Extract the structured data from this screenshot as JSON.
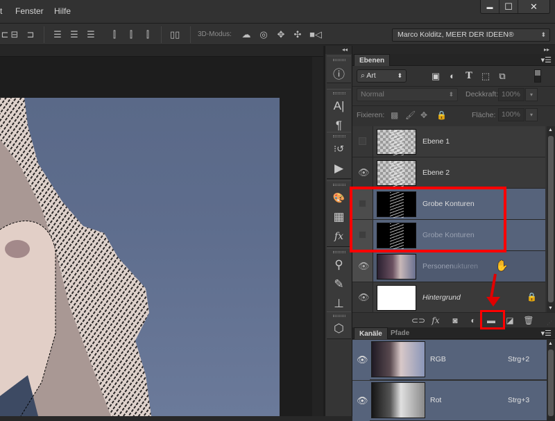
{
  "menu": {
    "items": [
      "t",
      "Fenster",
      "Hilfe"
    ]
  },
  "window_controls": {
    "minimize": "▬",
    "maximize": "☐",
    "close": "✕"
  },
  "options_bar": {
    "align_icons": [
      "align-left-edges-icon",
      "align-horizontal-centers-icon",
      "align-right-edges-icon",
      "distribute-top-icon",
      "distribute-vertical-centers-icon",
      "distribute-bottom-icon",
      "distribute-left-icon",
      "distribute-horizontal-centers-icon",
      "distribute-right-icon",
      "auto-align-icon"
    ],
    "mode3d_label": "3D-Modus:",
    "mode3d_icons": [
      "rotate-3d-icon",
      "roll-3d-icon",
      "drag-3d-icon",
      "slide-3d-icon",
      "scale-3d-camera-icon"
    ],
    "workspace": "Marco Kolditz, MEER DER IDEEN®"
  },
  "dock": {
    "collapse_glyph": "◂◂",
    "groups": [
      {
        "icons": [
          {
            "name": "info-icon",
            "glyph": "ⓘ"
          }
        ]
      },
      {
        "icons": [
          {
            "name": "character-icon",
            "glyph": "A|"
          },
          {
            "name": "paragraph-icon",
            "glyph": "¶"
          }
        ]
      },
      {
        "icons": [
          {
            "name": "history-icon",
            "glyph": "⁝↺"
          },
          {
            "name": "actions-play-icon",
            "glyph": "▶"
          }
        ]
      },
      {
        "icons": [
          {
            "name": "color-palette-icon",
            "glyph": "🎨"
          },
          {
            "name": "swatches-icon",
            "glyph": "▦"
          },
          {
            "name": "styles-fx-icon",
            "glyph": "fx"
          }
        ]
      },
      {
        "icons": [
          {
            "name": "brush-presets-icon",
            "glyph": "⚲"
          },
          {
            "name": "brush-icon",
            "glyph": "✎"
          },
          {
            "name": "clone-source-icon",
            "glyph": "⊥"
          }
        ]
      },
      {
        "icons": [
          {
            "name": "3d-icon",
            "glyph": "⬡"
          }
        ]
      }
    ]
  },
  "layers_panel": {
    "tab": "Ebenen",
    "expand_glyph": "▸▸",
    "filter": {
      "value": "Art",
      "search_glyph": "⌕"
    },
    "filter_icons": [
      {
        "name": "pixel-layer-filter-icon",
        "glyph": "▣"
      },
      {
        "name": "adjustment-layer-filter-icon",
        "glyph": "◐"
      },
      {
        "name": "type-layer-filter-icon",
        "glyph": "T"
      },
      {
        "name": "shape-layer-filter-icon",
        "glyph": "⬚"
      },
      {
        "name": "smart-object-filter-icon",
        "glyph": "⧉"
      }
    ],
    "blend_mode": "Normal",
    "opacity_label": "Deckkraft:",
    "opacity_value": "100%",
    "lock_label": "Fixieren:",
    "fill_label": "Fläche:",
    "fill_value": "100%",
    "layers": [
      {
        "name": "Ebene 1",
        "visible": false,
        "thumb": "checker",
        "selected": false
      },
      {
        "name": "Ebene 2",
        "visible": true,
        "thumb": "checker",
        "selected": false
      },
      {
        "name": "Grobe Konturen",
        "visible": false,
        "thumb": "black",
        "selected": true
      },
      {
        "name": "Grobe Konturen",
        "visible": false,
        "thumb": "black",
        "selected": true,
        "ghost_text": true
      },
      {
        "name": "Personen",
        "visible": true,
        "thumb": "photo",
        "selected": true,
        "ghost_text": true,
        "overlap_text": "ukturen"
      },
      {
        "name": "Hintergrund",
        "visible": true,
        "thumb": "white",
        "selected": false,
        "italic": true,
        "locked": true
      }
    ],
    "footer_icons": [
      {
        "name": "link-layers-icon",
        "glyph": "⊂⊃"
      },
      {
        "name": "layer-style-fx-icon",
        "glyph": "fx"
      },
      {
        "name": "add-mask-icon",
        "glyph": "◙"
      },
      {
        "name": "adjustment-layer-icon",
        "glyph": "◐"
      },
      {
        "name": "new-group-folder-icon",
        "glyph": "▬"
      },
      {
        "name": "new-layer-icon",
        "glyph": "◪"
      },
      {
        "name": "delete-layer-icon",
        "glyph": "🗑"
      }
    ]
  },
  "channels_panel": {
    "tabs": [
      "Kanäle",
      "Pfade"
    ],
    "channels": [
      {
        "name": "RGB",
        "shortcut": "Strg+2"
      },
      {
        "name": "Rot",
        "shortcut": "Strg+3"
      }
    ]
  },
  "colors": {
    "annotation_red": "#ff0000",
    "selected_layer": "#56637b",
    "panel_bg": "#323232"
  }
}
